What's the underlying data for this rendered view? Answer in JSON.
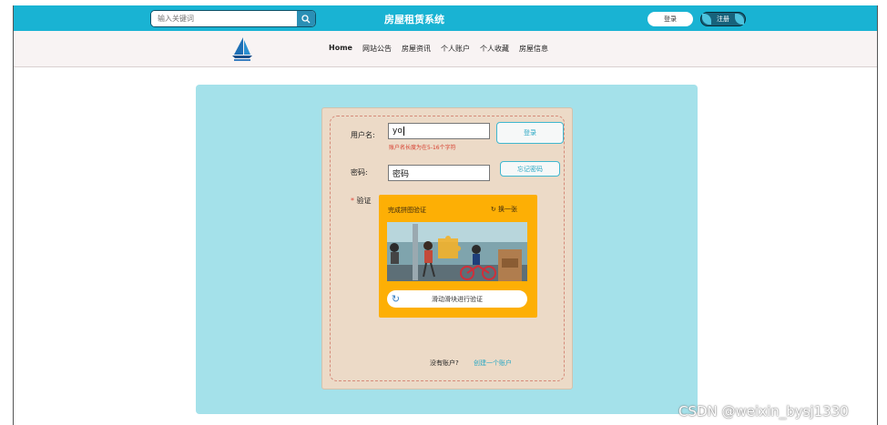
{
  "header": {
    "search_placeholder": "输入关键词",
    "search_icon": "search-icon",
    "site_title": "房屋租赁系统",
    "login_label": "登录",
    "register_label": "注册",
    "colors": {
      "topbar": "#19b3d3",
      "panel": "#a4e1ea",
      "card": "#ecdac7",
      "captcha": "#fdaf05"
    }
  },
  "nav": {
    "logo_icon": "sailboat-logo-icon",
    "items": [
      "Home",
      "网站公告",
      "房屋资讯",
      "个人账户",
      "个人收藏",
      "房屋信息"
    ]
  },
  "form": {
    "username_label": "用户名:",
    "username_value": "yo",
    "username_error": "账户名长度为在5-16个字符",
    "login_button": "登录",
    "password_label": "密码:",
    "password_value": "密码",
    "forgot_button": "忘记密码",
    "captcha_label": "验证",
    "captcha_required_mark": "*"
  },
  "captcha": {
    "title": "完成拼图验证",
    "refresh_label": "换一张",
    "refresh_icon": "refresh-icon",
    "slider_text": "滑动滑块进行验证",
    "slider_icon": "refresh-icon"
  },
  "footer": {
    "no_account": "没有账户?",
    "create_account": "创建一个账户"
  },
  "watermark": "CSDN @weixin_bysj1330"
}
